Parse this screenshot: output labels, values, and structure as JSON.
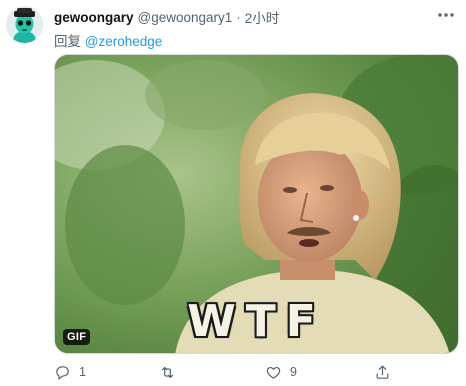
{
  "tweet": {
    "display_name": "gewoongary",
    "handle": "@gewoongary1",
    "separator": "·",
    "time": "2小时",
    "reply_prefix": "回复",
    "reply_mention": "@zerohedge",
    "media": {
      "badge": "GIF",
      "caption": "WTF"
    },
    "actions": {
      "reply_count": "1",
      "retweet_count": "",
      "like_count": "9",
      "share_count": ""
    }
  },
  "icons": {
    "more": "more-horizontal-icon",
    "reply": "reply-icon",
    "retweet": "retweet-icon",
    "like": "heart-icon",
    "share": "share-icon"
  },
  "colors": {
    "text_primary": "#0f1419",
    "text_secondary": "#536471",
    "link": "#1d9bf0"
  }
}
